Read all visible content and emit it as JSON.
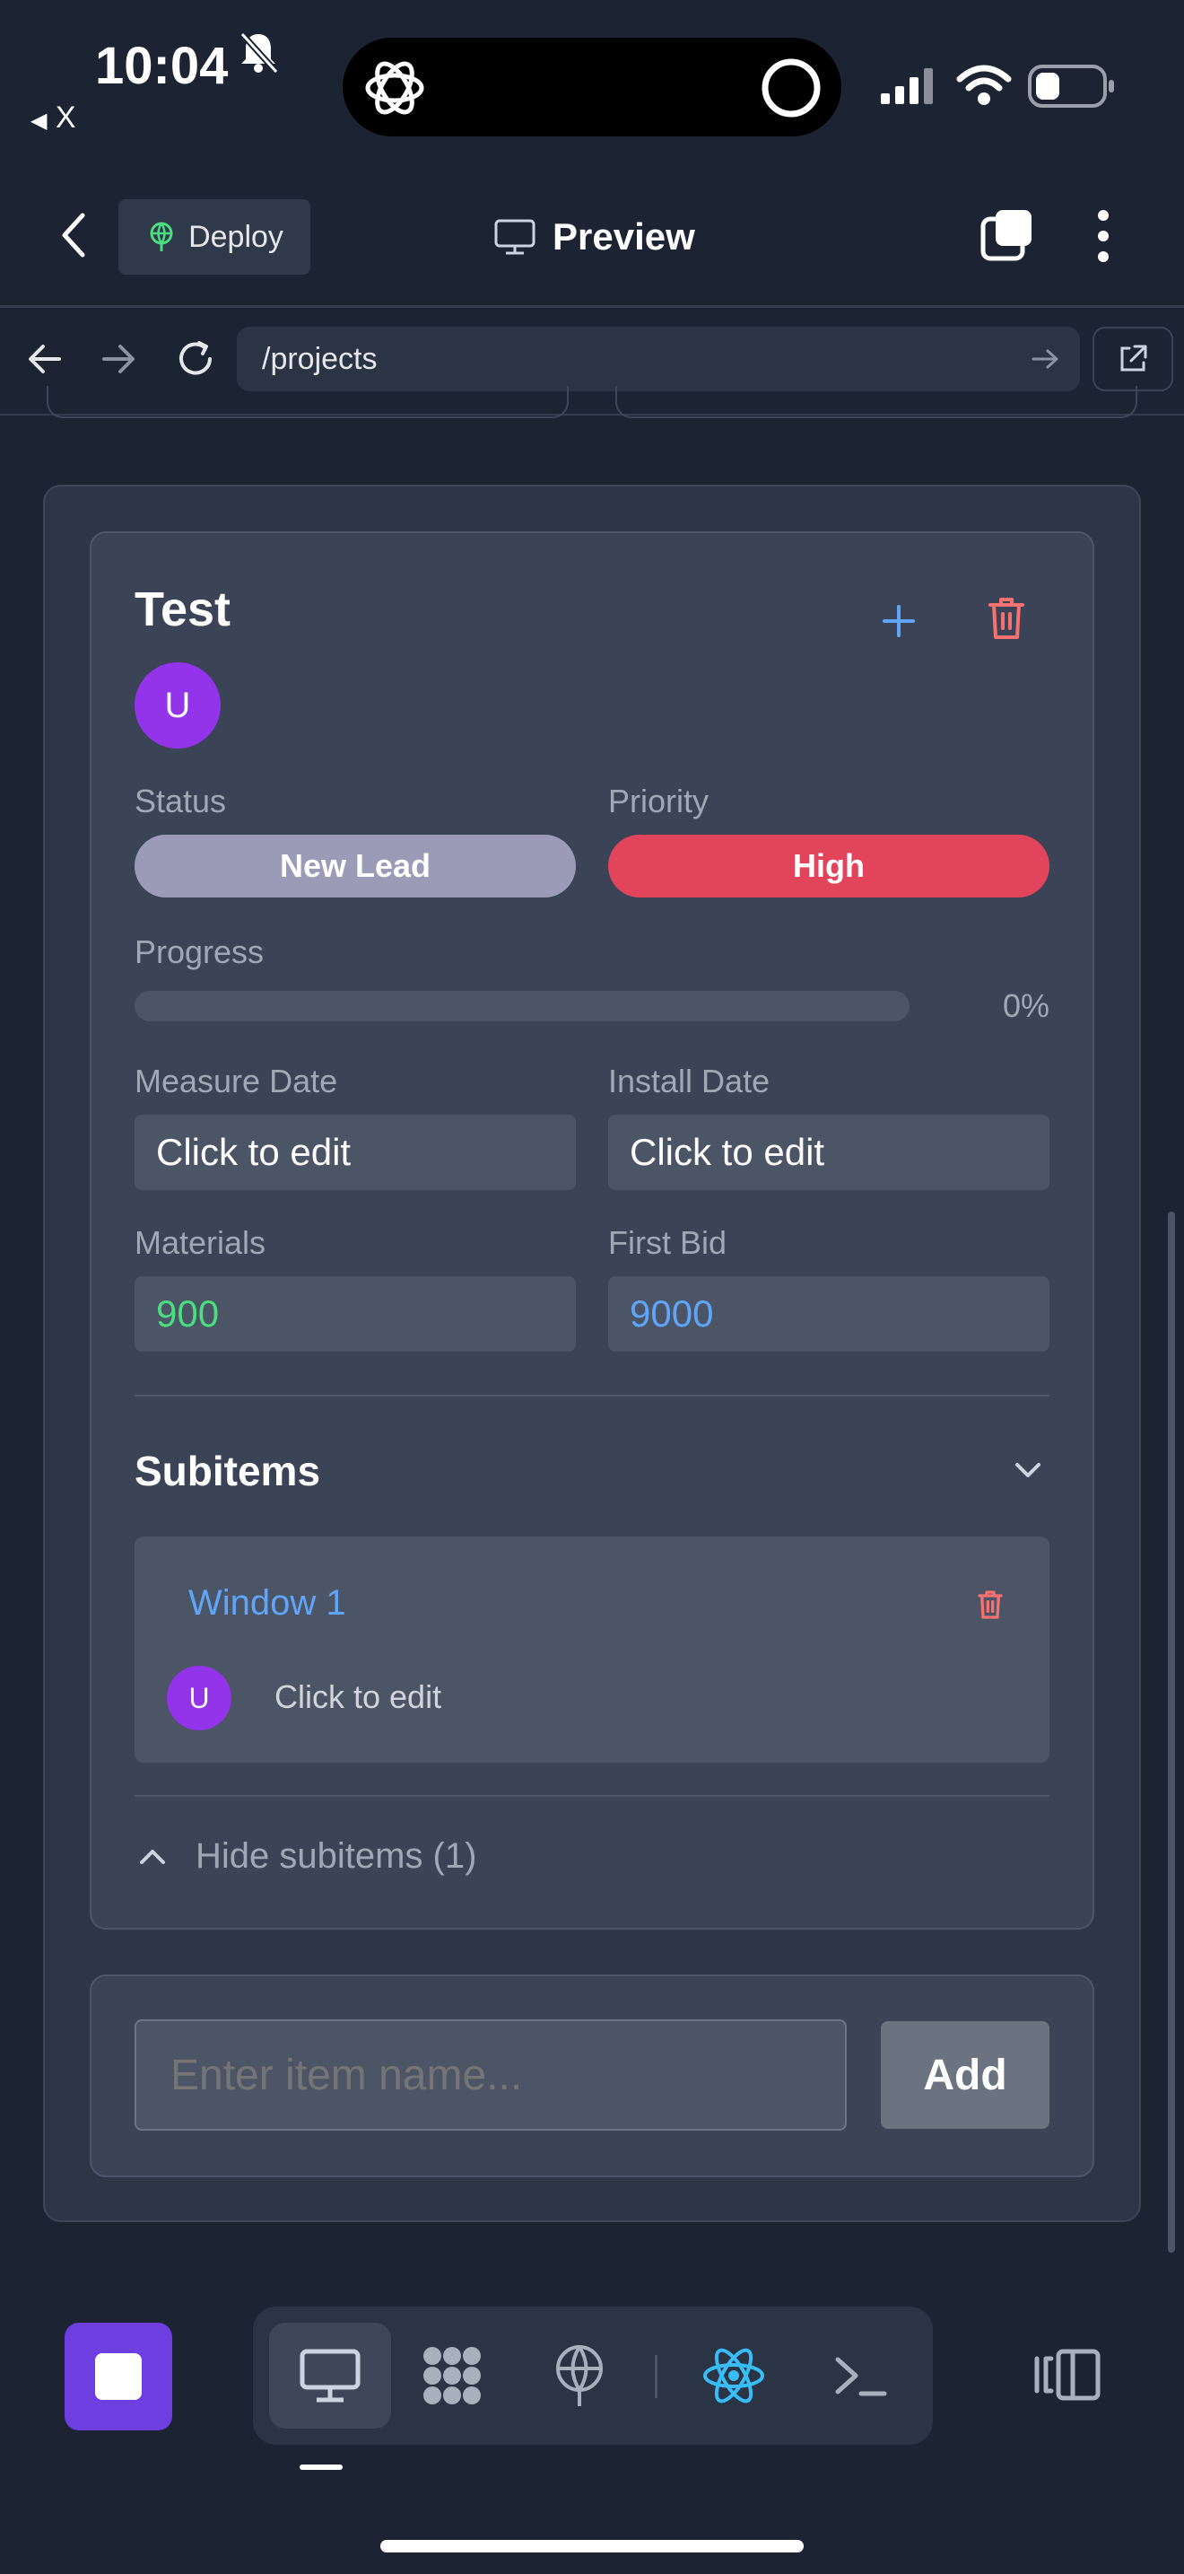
{
  "status_bar": {
    "time": "10:04",
    "back_app": "X"
  },
  "header": {
    "deploy_label": "Deploy",
    "title": "Preview"
  },
  "url_bar": {
    "path": "/projects"
  },
  "project": {
    "title": "Test",
    "avatar_initial": "U",
    "status_label": "Status",
    "status_value": "New Lead",
    "priority_label": "Priority",
    "priority_value": "High",
    "progress_label": "Progress",
    "progress_value": 0,
    "progress_text": "0%",
    "measure_date_label": "Measure Date",
    "measure_date_value": "Click to edit",
    "install_date_label": "Install Date",
    "install_date_value": "Click to edit",
    "materials_label": "Materials",
    "materials_value": "900",
    "first_bid_label": "First Bid",
    "first_bid_value": "9000"
  },
  "subitems": {
    "heading": "Subitems",
    "items": [
      {
        "name": "Window 1",
        "avatar_initial": "U",
        "value": "Click to edit"
      }
    ],
    "toggle_label": "Hide subitems (1)"
  },
  "add_item": {
    "placeholder": "Enter item name...",
    "button_label": "Add"
  },
  "colors": {
    "status_pill": "#9b9bb8",
    "priority_pill": "#e2445c",
    "materials_text": "#4ade80",
    "first_bid_text": "#60a5fa",
    "subitem_title": "#60a5fa",
    "delete_icon": "#f87171",
    "add_icon": "#60a5fa",
    "avatar": "#9333ea",
    "stop_button": "#6d3fe0"
  }
}
